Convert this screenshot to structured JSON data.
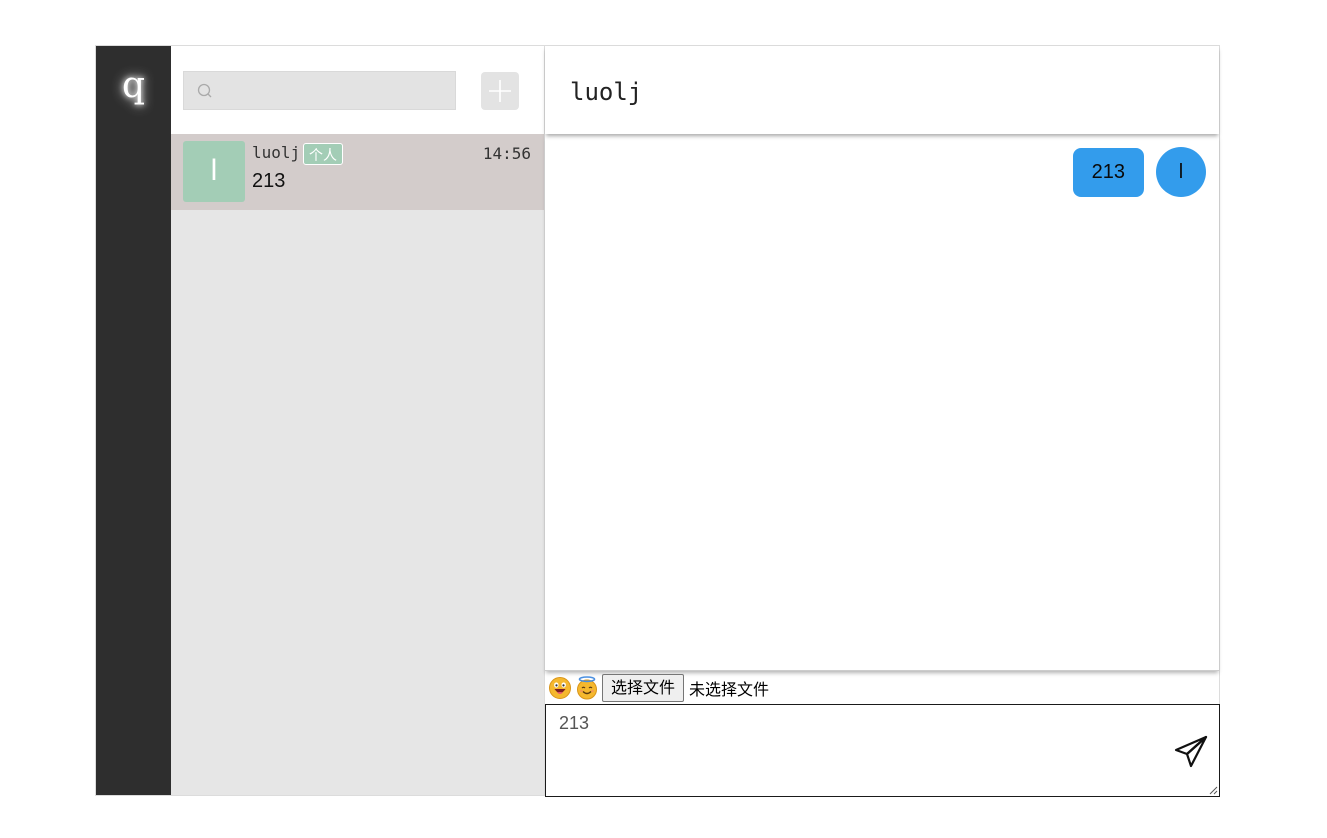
{
  "rail": {
    "user_initial": "q"
  },
  "list": {
    "search": {
      "value": "",
      "placeholder": ""
    },
    "add_icon": "plus-icon",
    "conversations": [
      {
        "avatar_initial": "l",
        "name": "luolj",
        "badge": "个人",
        "time": "14:56",
        "preview": "213"
      }
    ]
  },
  "chat": {
    "title": "luolj",
    "messages": [
      {
        "text": "213",
        "avatar_initial": "l",
        "side": "right"
      }
    ],
    "toolbar": {
      "emoji_1": "grinning-face-icon",
      "emoji_2": "smiling-face-with-halo-icon",
      "file_button": "选择文件",
      "file_status": "未选择文件"
    },
    "input": {
      "value": "213"
    },
    "send_icon": "paper-plane-icon"
  },
  "colors": {
    "rail_bg": "#2e2e2e",
    "list_bg": "#e6e6e6",
    "active_item_bg": "#d3cccb",
    "avatar_green": "#a3cdb6",
    "bubble_blue": "#339cec"
  }
}
